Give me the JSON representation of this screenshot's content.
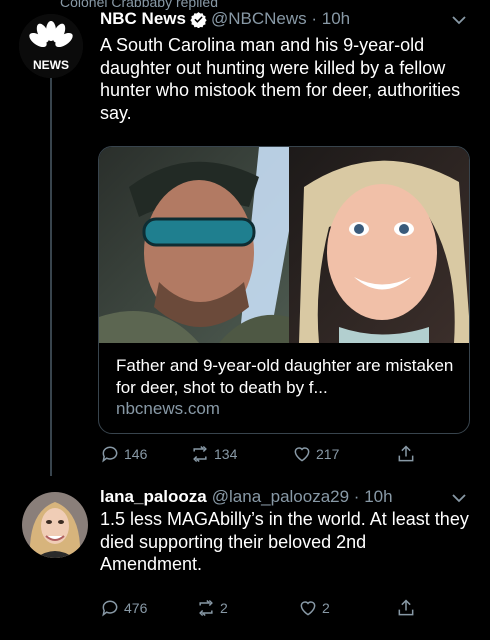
{
  "top_partial": "Colonel Crabbaby replied",
  "tweet1": {
    "avatar_text": "NEWS",
    "name": "NBC News",
    "handle": "@NBCNews",
    "time": "10h",
    "text": "A South Carolina man and his 9-year-old daughter out hunting were killed by a fellow hunter who mistook them for deer, authorities say.",
    "card": {
      "title": "Father and 9-year-old daughter are mistaken for deer, shot to death by f...",
      "domain": "nbcnews.com"
    },
    "replies": "146",
    "retweets": "134",
    "likes": "217"
  },
  "tweet2": {
    "name": "lana_palooza",
    "handle": "@lana_palooza29",
    "time": "10h",
    "text": "1.5 less MAGAbilly’s in the world. At least they died supporting their beloved 2nd Amendment.",
    "replies": "476",
    "retweets": "2",
    "likes": "2"
  },
  "colors": {
    "secondary_text": "#8899a6",
    "verified": "#1da1f2",
    "divider": "#38444d"
  }
}
